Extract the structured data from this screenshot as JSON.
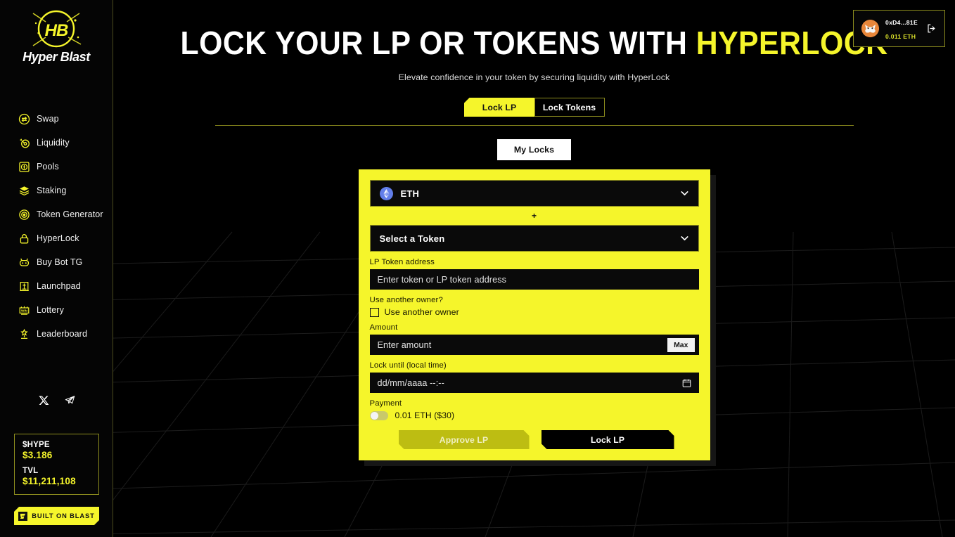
{
  "brand": {
    "logo_text": "Hyper Blast",
    "logo_mark": "HB"
  },
  "sidebar": {
    "items": [
      {
        "icon": "swap-icon",
        "label": "Swap"
      },
      {
        "icon": "liquidity-icon",
        "label": "Liquidity"
      },
      {
        "icon": "pools-icon",
        "label": "Pools"
      },
      {
        "icon": "staking-icon",
        "label": "Staking"
      },
      {
        "icon": "token-generator-icon",
        "label": "Token Generator"
      },
      {
        "icon": "lock-icon",
        "label": "HyperLock"
      },
      {
        "icon": "bot-icon",
        "label": "Buy Bot TG"
      },
      {
        "icon": "launchpad-icon",
        "label": "Launchpad"
      },
      {
        "icon": "lottery-icon",
        "label": "Lottery"
      },
      {
        "icon": "leaderboard-icon",
        "label": "Leaderboard"
      }
    ],
    "socials": [
      {
        "icon": "x-twitter-icon",
        "name": "X"
      },
      {
        "icon": "telegram-icon",
        "name": "Telegram"
      }
    ],
    "stats": {
      "price_label": "$HYPE",
      "price_value": "$3.186",
      "tvl_label": "TVL",
      "tvl_value": "$11,211,108"
    },
    "blast_badge": "BUILT ON BLAST"
  },
  "wallet": {
    "address": "0xD4...81E",
    "balance": "0.011 ETH",
    "logout_icon": "logout-icon",
    "avatar_icon": "metamask-fox-avatar"
  },
  "header": {
    "title_main": "LOCK YOUR LP OR TOKENS WITH ",
    "title_accent": "HYPERLOCK",
    "subtitle": "Elevate confidence in your token by securing liquidity with HyperLock"
  },
  "tabs": {
    "items": [
      {
        "label": "Lock LP",
        "active": true
      },
      {
        "label": "Lock Tokens",
        "active": false
      }
    ]
  },
  "my_locks_label": "My Locks",
  "form": {
    "chain_select": {
      "value": "ETH",
      "coin_icon": "ethereum-icon",
      "chevron": "chevron-down-icon"
    },
    "plus_separator": "+",
    "token_select": {
      "value": "Select a Token",
      "chevron": "chevron-down-icon"
    },
    "lp_address": {
      "label": "LP Token address",
      "placeholder": "Enter token or LP token address",
      "value": ""
    },
    "owner": {
      "label": "Use another owner?",
      "checkbox_label": "Use another owner",
      "checked": false
    },
    "amount": {
      "label": "Amount",
      "placeholder": "Enter amount",
      "value": "",
      "max_label": "Max"
    },
    "lock_until": {
      "label": "Lock until (local time)",
      "placeholder": "dd/mm/aaaa --:--",
      "value": "",
      "icon": "calendar-icon"
    },
    "payment": {
      "label": "Payment",
      "fee_label": "0.01 ETH ($30)",
      "toggle_on": false
    },
    "buttons": {
      "approve": "Approve LP",
      "lock": "Lock LP"
    }
  },
  "colors": {
    "accent_yellow": "#f5f52b",
    "border_olive": "#8d8d1e",
    "background": "#000000",
    "eth_blue": "#627eea",
    "approve_disabled": "#bdbd12"
  }
}
